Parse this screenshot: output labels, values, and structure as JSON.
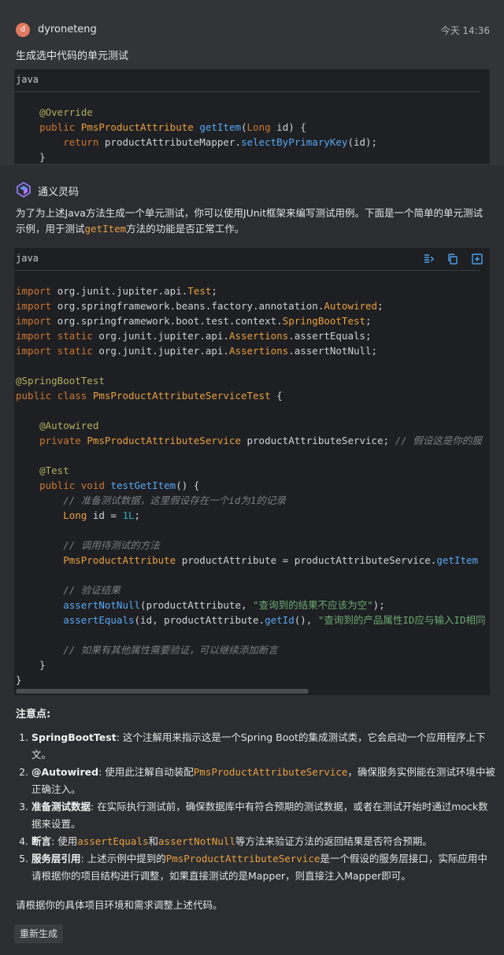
{
  "user": {
    "avatar_letter": "d",
    "name": "dyroneteng",
    "timestamp": "今天 14:36",
    "message": "生成选中代码的单元测试"
  },
  "selected_code": {
    "language": "java",
    "lines": [
      [],
      [
        {
          "t": "    @Override",
          "c": "ann"
        }
      ],
      [
        {
          "t": "    public ",
          "c": "kw"
        },
        {
          "t": "PmsProductAttribute ",
          "c": "cls"
        },
        {
          "t": "getItem",
          "c": "fn"
        },
        {
          "t": "(",
          "c": "plain"
        },
        {
          "t": "Long",
          "c": "kw"
        },
        {
          "t": " id) {",
          "c": "plain"
        }
      ],
      [
        {
          "t": "        return ",
          "c": "kw"
        },
        {
          "t": "productAttributeMapper.",
          "c": "plain"
        },
        {
          "t": "selectByPrimaryKey",
          "c": "fn"
        },
        {
          "t": "(id);",
          "c": "plain"
        }
      ],
      [
        {
          "t": "    }",
          "c": "plain"
        }
      ]
    ]
  },
  "assistant": {
    "name": "通义灵码",
    "intro_before": "为了为上述Java方法生成一个单元测试，你可以使用JUnit框架来编写测试用例。下面是一个简单的单元测试示例，用于测试",
    "intro_code": "getItem",
    "intro_after": "方法的功能是否正常工作。"
  },
  "test_code": {
    "language": "java",
    "toolbar": [
      "insert-icon",
      "copy-icon",
      "new-file-icon"
    ],
    "lines": [
      [],
      [
        {
          "t": "import ",
          "c": "kw"
        },
        {
          "t": "org.junit.jupiter.api.",
          "c": "plain"
        },
        {
          "t": "Test",
          "c": "cls"
        },
        {
          "t": ";",
          "c": "plain"
        }
      ],
      [
        {
          "t": "import ",
          "c": "kw"
        },
        {
          "t": "org.springframework.beans.factory.annotation.",
          "c": "plain"
        },
        {
          "t": "Autowired",
          "c": "cls"
        },
        {
          "t": ";",
          "c": "plain"
        }
      ],
      [
        {
          "t": "import ",
          "c": "kw"
        },
        {
          "t": "org.springframework.boot.test.context.",
          "c": "plain"
        },
        {
          "t": "SpringBootTest",
          "c": "cls"
        },
        {
          "t": ";",
          "c": "plain"
        }
      ],
      [
        {
          "t": "import static ",
          "c": "kw"
        },
        {
          "t": "org.junit.jupiter.api.",
          "c": "plain"
        },
        {
          "t": "Assertions",
          "c": "cls"
        },
        {
          "t": ".assertEquals;",
          "c": "plain"
        }
      ],
      [
        {
          "t": "import static ",
          "c": "kw"
        },
        {
          "t": "org.junit.jupiter.api.",
          "c": "plain"
        },
        {
          "t": "Assertions",
          "c": "cls"
        },
        {
          "t": ".assertNotNull;",
          "c": "plain"
        }
      ],
      [],
      [
        {
          "t": "@SpringBootTest",
          "c": "ann"
        }
      ],
      [
        {
          "t": "public class ",
          "c": "kw"
        },
        {
          "t": "PmsProductAttributeServiceTest",
          "c": "cls"
        },
        {
          "t": " {",
          "c": "plain"
        }
      ],
      [],
      [
        {
          "t": "    @Autowired",
          "c": "ann"
        }
      ],
      [
        {
          "t": "    private ",
          "c": "kw"
        },
        {
          "t": "PmsProductAttributeService",
          "c": "cls"
        },
        {
          "t": " productAttributeService; ",
          "c": "plain"
        },
        {
          "t": "// 假设这是你的服",
          "c": "com"
        }
      ],
      [],
      [
        {
          "t": "    @Test",
          "c": "ann"
        }
      ],
      [
        {
          "t": "    public void ",
          "c": "kw"
        },
        {
          "t": "testGetItem",
          "c": "fn"
        },
        {
          "t": "() {",
          "c": "plain"
        }
      ],
      [
        {
          "t": "        // 准备测试数据，这里假设存在一个id为1的记录",
          "c": "com"
        }
      ],
      [
        {
          "t": "        Long",
          "c": "cls"
        },
        {
          "t": " id = ",
          "c": "plain"
        },
        {
          "t": "1L",
          "c": "num"
        },
        {
          "t": ";",
          "c": "plain"
        }
      ],
      [],
      [
        {
          "t": "        // 调用待测试的方法",
          "c": "com"
        }
      ],
      [
        {
          "t": "        PmsProductAttribute",
          "c": "cls"
        },
        {
          "t": " productAttribute = productAttributeService.",
          "c": "plain"
        },
        {
          "t": "getItem",
          "c": "fn"
        }
      ],
      [],
      [
        {
          "t": "        // 验证结果",
          "c": "com"
        }
      ],
      [
        {
          "t": "        assertNotNull",
          "c": "fn"
        },
        {
          "t": "(productAttribute, ",
          "c": "plain"
        },
        {
          "t": "\"查询到的结果不应该为空\"",
          "c": "str"
        },
        {
          "t": ");",
          "c": "plain"
        }
      ],
      [
        {
          "t": "        assertEquals",
          "c": "fn"
        },
        {
          "t": "(id, productAttribute.",
          "c": "plain"
        },
        {
          "t": "getId",
          "c": "fn"
        },
        {
          "t": "(), ",
          "c": "plain"
        },
        {
          "t": "\"查询到的产品属性ID应与输入ID相同",
          "c": "str"
        }
      ],
      [],
      [
        {
          "t": "        // 如果有其他属性需要验证，可以继续添加断言",
          "c": "com"
        }
      ],
      [
        {
          "t": "    }",
          "c": "plain"
        }
      ],
      [
        {
          "t": "}",
          "c": "plain"
        }
      ]
    ]
  },
  "notes": {
    "title": "注意点:",
    "items": [
      {
        "label": "SpringBootTest",
        "segments": [
          {
            "t": ": 这个注解用来指示这是一个Spring Boot的集成测试类，它会启动一个应用程序上下文。",
            "m": false
          }
        ]
      },
      {
        "label": "@Autowired",
        "segments": [
          {
            "t": ": 使用此注解自动装配",
            "m": false
          },
          {
            "t": "PmsProductAttributeService",
            "m": true
          },
          {
            "t": "，确保服务实例能在测试环境中被正确注入。",
            "m": false
          }
        ]
      },
      {
        "label": "准备测试数据",
        "segments": [
          {
            "t": ": 在实际执行测试前，确保数据库中有符合预期的测试数据，或者在测试开始时通过mock数据来设置。",
            "m": false
          }
        ]
      },
      {
        "label": "断言",
        "segments": [
          {
            "t": ": 使用",
            "m": false
          },
          {
            "t": "assertEquals",
            "m": true
          },
          {
            "t": "和",
            "m": false
          },
          {
            "t": "assertNotNull",
            "m": true
          },
          {
            "t": "等方法来验证方法的返回结果是否符合预期。",
            "m": false
          }
        ]
      },
      {
        "label": "服务层引用",
        "segments": [
          {
            "t": ": 上述示例中提到的",
            "m": false
          },
          {
            "t": "PmsProductAttributeService",
            "m": true
          },
          {
            "t": "是一个假设的服务层接口，实际应用中请根据你的项目结构进行调整，如果直接测试的是Mapper，则直接注入Mapper即可。",
            "m": false
          }
        ]
      }
    ]
  },
  "closing": "请根据你的具体项目环境和需求调整上述代码。",
  "regenerate_label": "重新生成"
}
